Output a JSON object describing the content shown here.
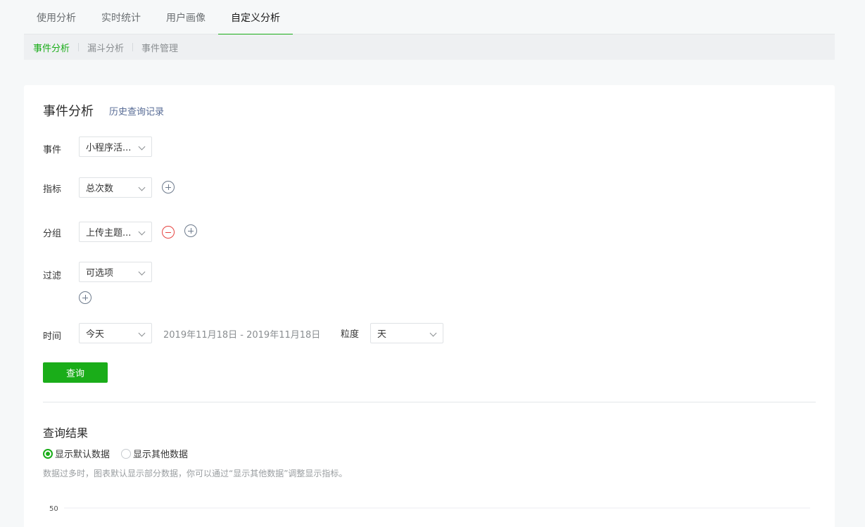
{
  "top_tabs": [
    "使用分析",
    "实时统计",
    "用户画像",
    "自定义分析"
  ],
  "sub_tabs": [
    "事件分析",
    "漏斗分析",
    "事件管理"
  ],
  "card": {
    "title": "事件分析",
    "history_link": "历史查询记录"
  },
  "form": {
    "event": {
      "label": "事件",
      "value": "小程序活..."
    },
    "metric": {
      "label": "指标",
      "value": "总次数"
    },
    "group": {
      "label": "分组",
      "value": "上传主题..."
    },
    "filter": {
      "label": "过滤",
      "value": "可选项"
    },
    "time": {
      "label": "时间",
      "value": "今天",
      "range": "2019年11月18日 - 2019年11月18日"
    },
    "granularity": {
      "label": "粒度",
      "value": "天"
    },
    "query_button": "查询"
  },
  "results": {
    "title": "查询结果",
    "radio_default": "显示默认数据",
    "radio_other": "显示其他数据",
    "note": "数据过多时，图表默认显示部分数据，你可以通过“显示其他数据”调整显示指标。",
    "axis_tick": "50"
  },
  "colors": {
    "accent": "#1aad19",
    "link": "#576b95",
    "danger": "#e64340"
  }
}
